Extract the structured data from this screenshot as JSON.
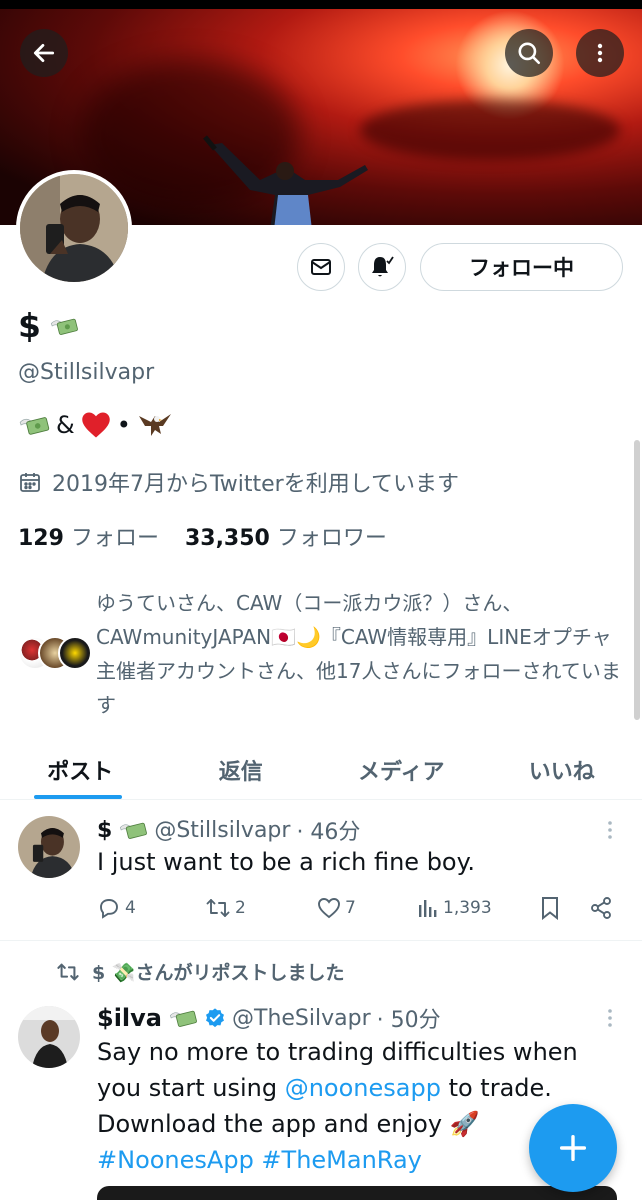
{
  "header": {
    "back_icon": "arrow-left-icon",
    "search_icon": "search-icon",
    "more_icon": "more-vertical-icon"
  },
  "profile": {
    "name": "$",
    "name_emoji": "money-with-wings",
    "handle": "@Stillsilvapr",
    "bio_amp": "&",
    "bio_dot": "•",
    "joined": "2019年7月からTwitterを利用しています",
    "following_count": "129",
    "following_label": "フォロー",
    "followers_count": "33,350",
    "followers_label": "フォロワー",
    "followed_by": "ゆうていさん、CAW（コー派カウ派？）さん、CAWmunityJAPAN🇯🇵🌙『CAW情報専用』LINEオプチャ主催者アカウントさん、他17人さんにフォローされています",
    "follow_button": "フォロー中"
  },
  "tabs": [
    "ポスト",
    "返信",
    "メディア",
    "いいね"
  ],
  "posts": [
    {
      "name": "$",
      "handle": "@Stillsilvapr",
      "time": "· 46分",
      "text": "I just want to be a rich fine boy.",
      "replies": "4",
      "reposts": "2",
      "likes": "7",
      "views": "1,393"
    }
  ],
  "repost": {
    "label": "$ 💸さんがリポストしました",
    "name": "$ilva",
    "handle": "@TheSilvapr",
    "time": "· 50分",
    "text_1": "Say no more to trading difficulties when you start using ",
    "mention": "@noonesapp",
    "text_2": " to trade. Download the app and enjoy 🚀",
    "hashtags": "#NoonesApp #TheManRay"
  },
  "colors": {
    "accent": "#1d9bf0",
    "text": "#0f1419",
    "secondary": "#536471"
  }
}
